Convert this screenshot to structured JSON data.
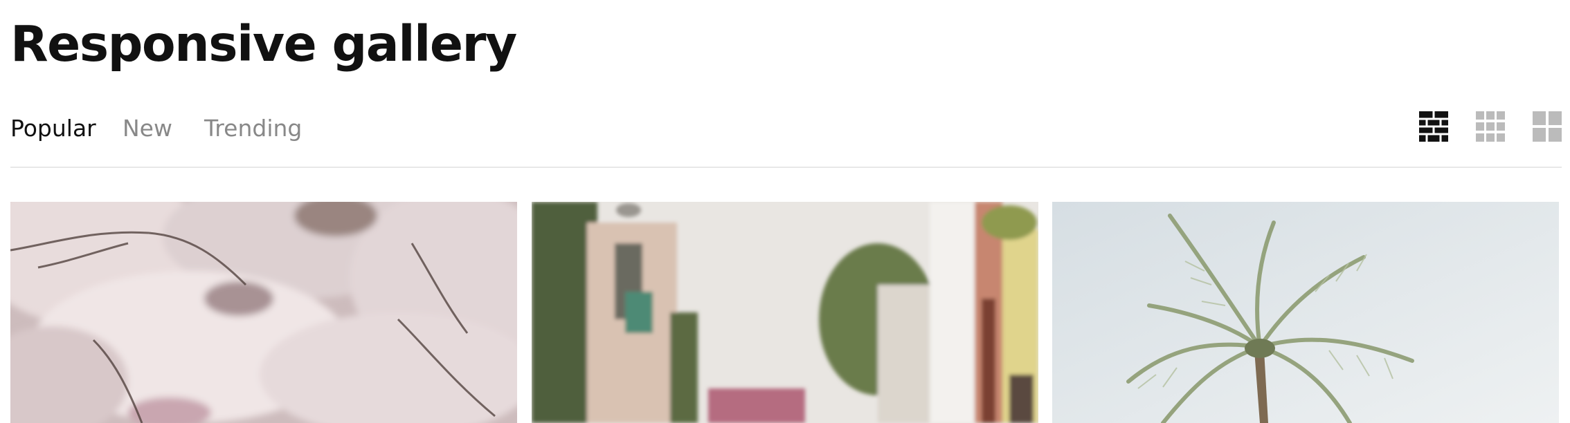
{
  "page": {
    "title": "Responsive gallery"
  },
  "tabs": [
    {
      "label": "Popular",
      "active": true
    },
    {
      "label": "New",
      "active": false
    },
    {
      "label": "Trending",
      "active": false
    }
  ],
  "view_options": [
    {
      "icon": "brick-layout-icon",
      "active": true
    },
    {
      "icon": "small-grid-icon",
      "active": false
    },
    {
      "icon": "large-grid-icon",
      "active": false
    }
  ],
  "gallery": {
    "photos": [
      {
        "subject": "cherry-blossom-trees"
      },
      {
        "subject": "narrow-street-with-buildings"
      },
      {
        "subject": "palm-tree-under-sky"
      }
    ]
  },
  "colors": {
    "text_active": "#111111",
    "text_inactive": "#888888",
    "icon_active": "#111111",
    "icon_inactive": "#bbbbbb",
    "divider": "#e8e8e8"
  }
}
